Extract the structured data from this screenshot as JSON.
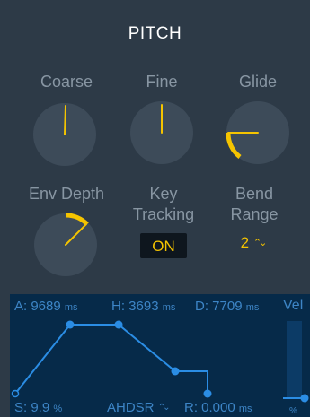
{
  "panel": {
    "title": "PITCH"
  },
  "knobs": {
    "coarse": {
      "label": "Coarse"
    },
    "fine": {
      "label": "Fine"
    },
    "glide": {
      "label": "Glide"
    },
    "env_depth": {
      "label": "Env Depth"
    },
    "key_tracking": {
      "label_line1": "Key",
      "label_line2": "Tracking",
      "button": "ON"
    },
    "bend_range": {
      "label_line1": "Bend",
      "label_line2": "Range",
      "value": "2",
      "stepper_icon": "⌃⌄"
    }
  },
  "envelope": {
    "attack": {
      "prefix": "A: ",
      "value": "9689",
      "unit": "ms"
    },
    "hold": {
      "prefix": "H: ",
      "value": "3693",
      "unit": "ms"
    },
    "decay": {
      "prefix": "D: ",
      "value": "7709",
      "unit": "ms"
    },
    "velocity_label": "Vel",
    "sustain": {
      "prefix": "S: ",
      "value": "9.9",
      "unit": "%"
    },
    "mode": "AHDSR",
    "mode_icon": "⌃⌄",
    "release": {
      "prefix": "R: ",
      "value": "0.000",
      "unit": "ms"
    },
    "velocity_unit": "%"
  },
  "colors": {
    "background": "#2d3a47",
    "accent": "#f5c400",
    "envelope_bg": "#062a49",
    "envelope_line": "#2b8de4",
    "label": "#8896a3"
  }
}
